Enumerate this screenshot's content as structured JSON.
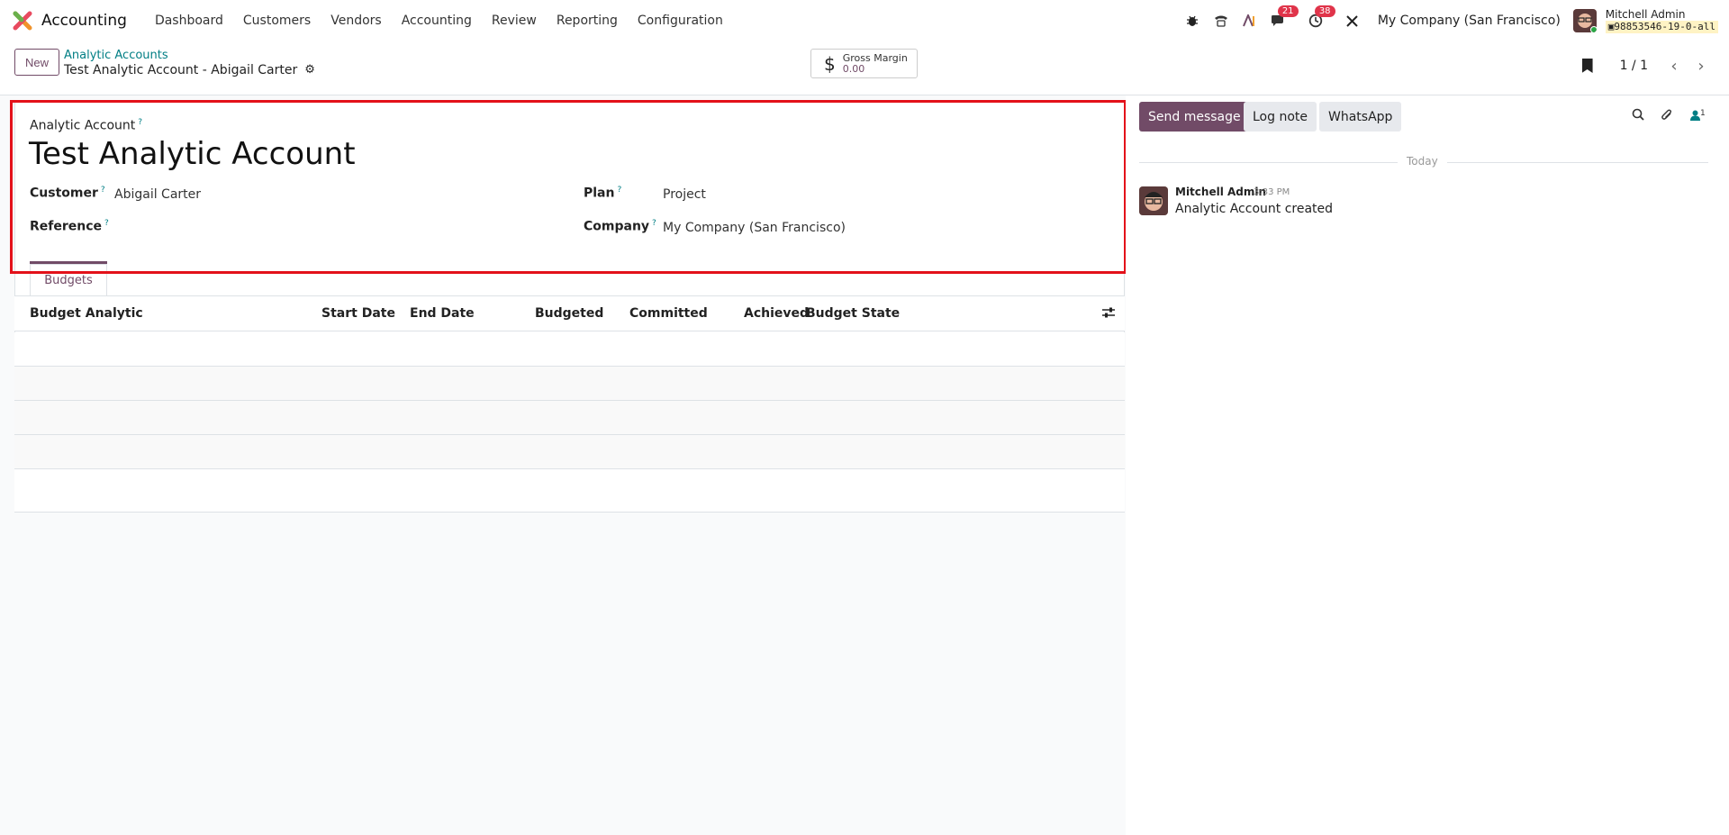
{
  "app": {
    "title": "Accounting",
    "menu": [
      "Dashboard",
      "Customers",
      "Vendors",
      "Accounting",
      "Review",
      "Reporting",
      "Configuration"
    ],
    "messages_badge": "21",
    "activities_badge": "38",
    "company": "My Company (San Francisco)",
    "user_name": "Mitchell Admin",
    "database": "98853546-19-0-all"
  },
  "control": {
    "new_label": "New",
    "breadcrumb_parent": "Analytic Accounts",
    "breadcrumb_current": "Test Analytic Account - Abigail Carter",
    "stat_label": "Gross Margin",
    "stat_value": "0.00",
    "pager": "1 / 1"
  },
  "form": {
    "account_label": "Analytic Account",
    "account_name": "Test Analytic Account",
    "customer_label": "Customer",
    "customer_value": "Abigail Carter",
    "reference_label": "Reference",
    "reference_value": "",
    "plan_label": "Plan",
    "plan_value": "Project",
    "company_label": "Company",
    "company_value": "My Company (San Francisco)",
    "tab_label": "Budgets",
    "columns": [
      "Budget Analytic",
      "Start Date",
      "End Date",
      "Budgeted",
      "Committed",
      "Achieved",
      "Budget State"
    ]
  },
  "chatter": {
    "send_message": "Send message",
    "log_note": "Log note",
    "whatsapp": "WhatsApp",
    "followers": "1",
    "date_separator": "Today",
    "message": {
      "author": "Mitchell Admin",
      "time": "3:33 PM",
      "body": "Analytic Account created"
    }
  },
  "colors": {
    "brand": "#714b67",
    "link": "#017e84",
    "highlight": "#e3111a",
    "badge": "#e0344a"
  }
}
